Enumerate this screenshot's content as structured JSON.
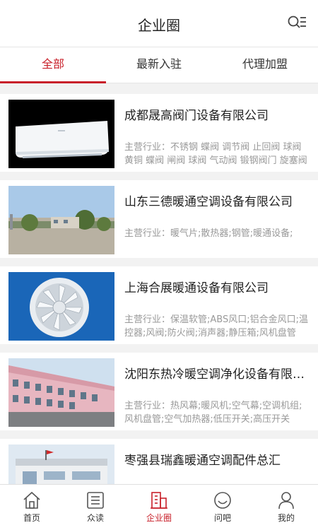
{
  "header": {
    "title": "企业圈",
    "menu_icon": "search-list-icon"
  },
  "tabs": [
    {
      "label": "全部",
      "active": true
    },
    {
      "label": "最新入驻",
      "active": false
    },
    {
      "label": "代理加盟",
      "active": false
    }
  ],
  "companies": [
    {
      "name": "成都晟高阀门设备有限公司",
      "desc": "主营行业：不锈钢 蝶阀 调节阀 止回阀 球阀 黄铜 蝶阀 闸阀 球阀 气动阀 锻钢阀门 旋塞阀",
      "image": "air-conditioner"
    },
    {
      "name": "山东三德暖通空调设备有限公司",
      "desc": "主营行业：暖气片;散热器;钢管;暖通设备;",
      "image": "factory-yard"
    },
    {
      "name": "上海合展暖通设备有限公司",
      "desc": "主营行业：保温软管;ABS风口;铝合金风口;温控器;风阀;防火阀;消声器;静压箱;风机盘管",
      "image": "round-diffuser"
    },
    {
      "name": "沈阳东热冷暖空调净化设备有限公司",
      "desc": "主营行业：热风幕;暖风机;空气幕;空调机组;风机盘管;空气加热器;低压开关;高压开关",
      "image": "pink-building"
    },
    {
      "name": "枣强县瑞鑫暖通空调配件总汇",
      "desc": "",
      "image": "office-building"
    }
  ],
  "bottom_nav": [
    {
      "label": "首页",
      "icon": "home-icon",
      "active": false
    },
    {
      "label": "众读",
      "icon": "list-icon",
      "active": false
    },
    {
      "label": "企业圈",
      "icon": "building-icon",
      "active": true
    },
    {
      "label": "问吧",
      "icon": "smile-icon",
      "active": false
    },
    {
      "label": "我的",
      "icon": "user-icon",
      "active": false
    }
  ],
  "colors": {
    "accent": "#c8202a",
    "background": "#f2f2f2"
  }
}
